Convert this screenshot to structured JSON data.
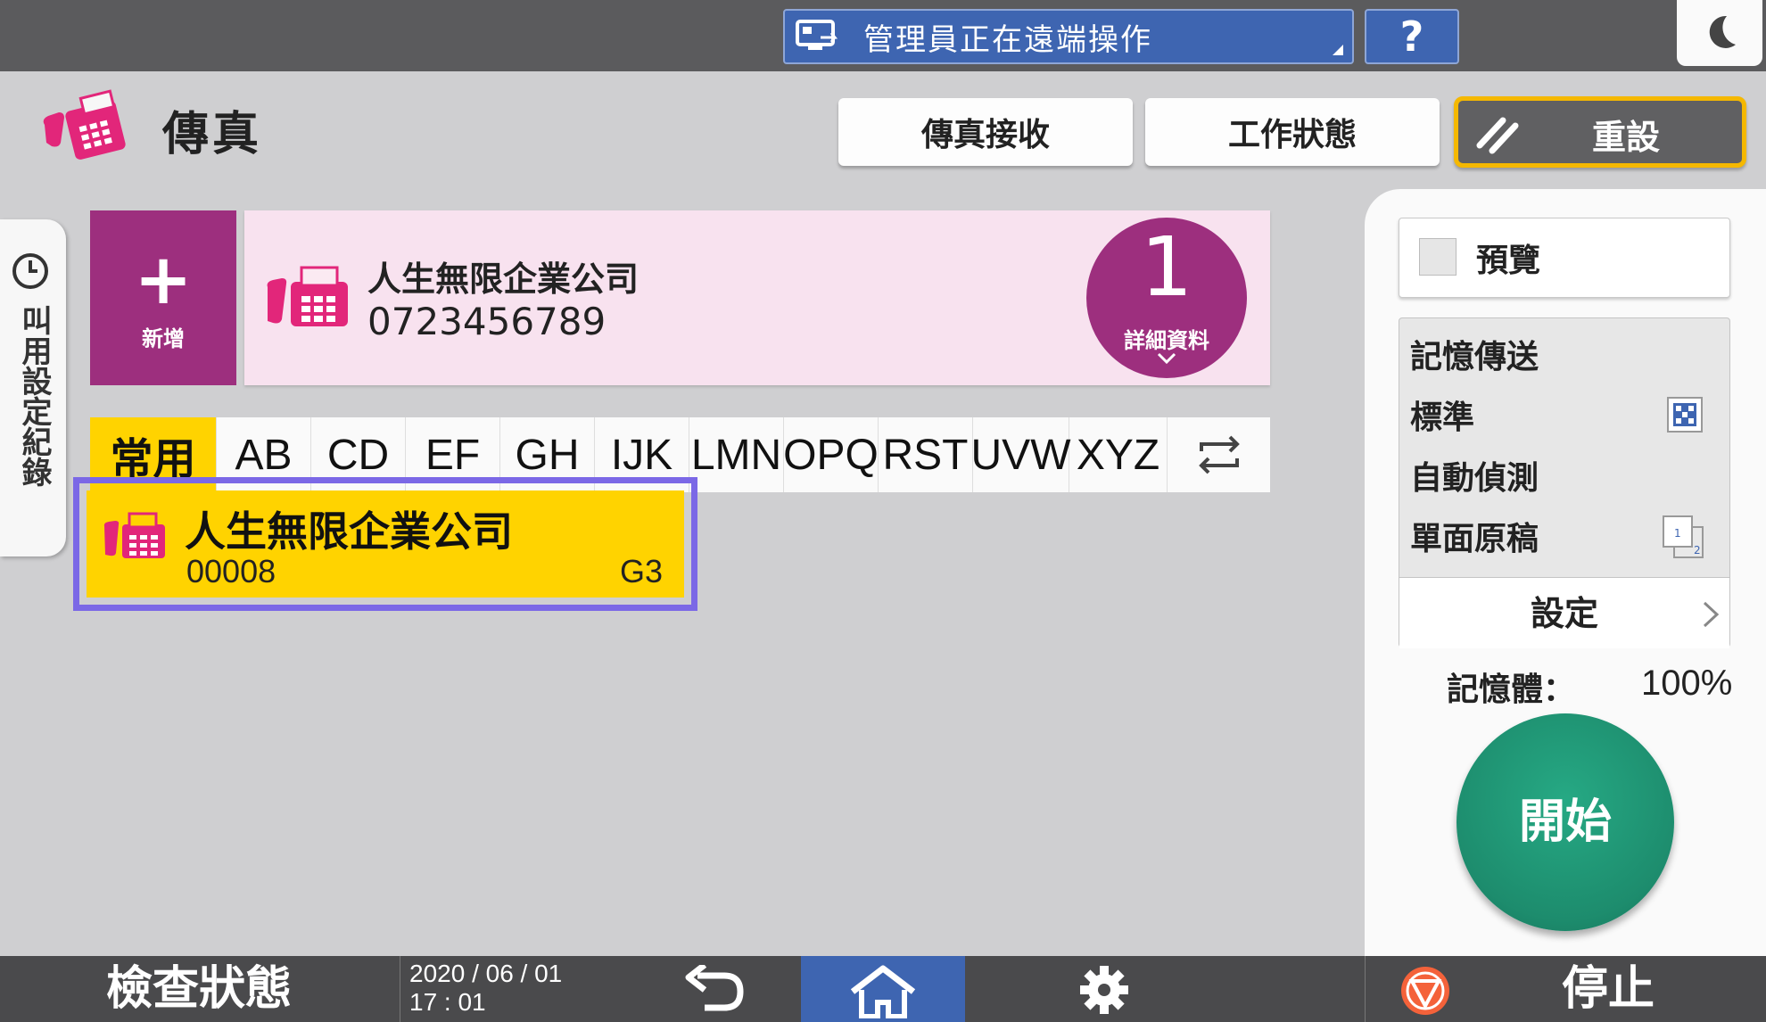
{
  "topbar": {
    "remote_banner": "管理員正在遠端操作",
    "help_label": "?"
  },
  "header": {
    "title": "傳真",
    "fax_receive": "傳真接收",
    "job_status": "工作狀態",
    "reset": "重設"
  },
  "history_tab": {
    "label": "叫用設定紀錄"
  },
  "destination": {
    "add_label": "新增",
    "name": "人生無限企業公司",
    "number": "0723456789",
    "count": "1",
    "details_label": "詳細資料"
  },
  "index_tabs": [
    "常用",
    "AB",
    "CD",
    "EF",
    "GH",
    "IJK",
    "LMN",
    "OPQ",
    "RST",
    "UVW",
    "XYZ"
  ],
  "entry": {
    "name": "人生無限企業公司",
    "id": "00008",
    "mode": "G3"
  },
  "right_panel": {
    "preview_label": "預覽",
    "memory_tx": "記憶傳送",
    "resolution": "標準",
    "detect": "自動偵測",
    "original": "單面原稿",
    "settings": "設定",
    "memory_label": "記憶體：",
    "memory_value": "100%",
    "start": "開始"
  },
  "bottombar": {
    "check_status": "檢查狀態",
    "date": "2020 / 06 / 01",
    "time": "17 : 01",
    "stop": "停止"
  },
  "colors": {
    "accent_magenta": "#9d2f7e",
    "selected_yellow": "#ffd300",
    "reset_border": "#f5b800",
    "start_green": "#1d8c6d",
    "selection_outline": "#7b68e6",
    "home_blue": "#3e65b1"
  },
  "icons": {
    "app": "fax-icon",
    "remote": "remote-desktop-icon",
    "sleep": "moon-icon",
    "history": "clock-icon",
    "swap": "swap-arrows-icon",
    "back": "back-arrow-icon",
    "home": "home-icon",
    "settings": "gear-icon",
    "stop": "stop-icon"
  }
}
